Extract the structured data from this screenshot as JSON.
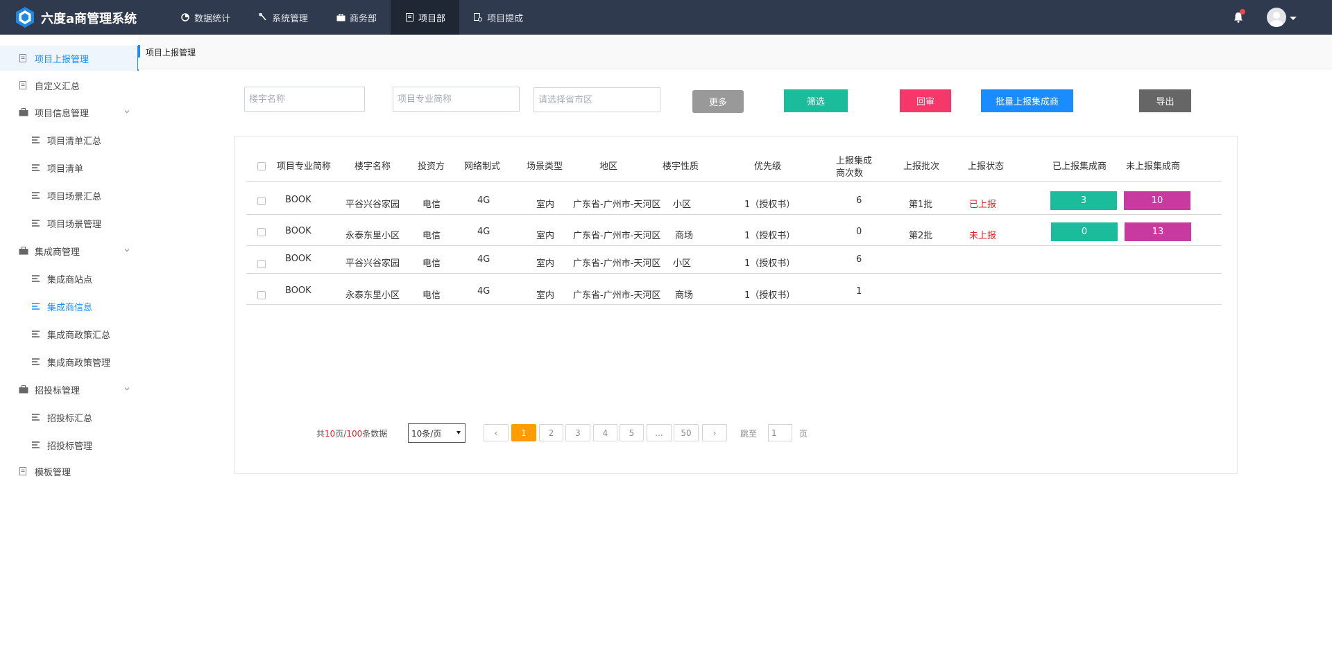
{
  "app": {
    "title": "六度a商管理系统",
    "nav": [
      {
        "label": "数据统计",
        "icon": "pie-chart-icon"
      },
      {
        "label": "系统管理",
        "icon": "wrench-icon"
      },
      {
        "label": "商务部",
        "icon": "briefcase-icon"
      },
      {
        "label": "项目部",
        "icon": "document-icon"
      },
      {
        "label": "项目提成",
        "icon": "commission-icon"
      }
    ],
    "active_nav": "项目部"
  },
  "sidebar": {
    "items": [
      {
        "label": "项目上报管理",
        "icon": "report-icon"
      },
      {
        "label": "自定义汇总",
        "icon": "report-icon"
      },
      {
        "label": "项目信息管理",
        "icon": "briefcase-icon"
      },
      {
        "label": "项目清单汇总",
        "icon": "list-icon"
      },
      {
        "label": "项目清单",
        "icon": "list-icon"
      },
      {
        "label": "项目场景汇总",
        "icon": "list-icon"
      },
      {
        "label": "项目场景管理",
        "icon": "list-icon"
      },
      {
        "label": "集成商管理",
        "icon": "briefcase-icon"
      },
      {
        "label": "集成商站点",
        "icon": "list-icon"
      },
      {
        "label": "集成商信息",
        "icon": "list-icon"
      },
      {
        "label": "集成商政策汇总",
        "icon": "list-icon"
      },
      {
        "label": "集成商政策管理",
        "icon": "list-icon"
      },
      {
        "label": "招投标管理",
        "icon": "briefcase-icon"
      },
      {
        "label": "招投标汇总",
        "icon": "list-icon"
      },
      {
        "label": "招投标管理",
        "icon": "list-icon"
      },
      {
        "label": "模板管理",
        "icon": "report-icon"
      }
    ]
  },
  "breadcrumb": "项目上报管理",
  "filters": {
    "building_placeholder": "楼宇名称",
    "project_abbr_placeholder": "项目专业简称",
    "region_placeholder": "请选择省市区",
    "more_label": "更多",
    "filter_label": "筛选",
    "review_label": "回审",
    "batch_report_label": "批量上报集成商",
    "export_label": "导出"
  },
  "colors": {
    "topbar": "#2f3a4e",
    "accent_blue": "#1a8cff",
    "teal": "#1abc9c",
    "magenta": "#c93aa1",
    "pink": "#f5386a",
    "gray_btn": "#999999",
    "dark_btn": "#666666",
    "orange": "#ff9c00",
    "status_red": "#e12424"
  },
  "table": {
    "headers": {
      "abbr": "项目专业简称",
      "building": "楼宇名称",
      "investor": "投资方",
      "network": "网络制式",
      "scene": "场景类型",
      "region": "地区",
      "nature": "楼宇性质",
      "priority": "优先级",
      "report_count_1": "上报集成",
      "report_count_2": "商次数",
      "batch": "上报批次",
      "status": "上报状态",
      "reported": "已上报集成商",
      "unreported": "未上报集成商"
    },
    "rows": [
      {
        "abbr": "BOOK",
        "building": "平谷兴谷家园",
        "investor": "电信",
        "network": "4G",
        "scene": "室内",
        "region": "广东省-广州市-天河区",
        "nature": "小区",
        "priority": "1（授权书）",
        "count": "6",
        "batch": "第1批",
        "status": "已上报",
        "reported": "3",
        "unreported": "10"
      },
      {
        "abbr": "BOOK",
        "building": "永泰东里小区",
        "investor": "电信",
        "network": "4G",
        "scene": "室内",
        "region": "广东省-广州市-天河区",
        "nature": "商场",
        "priority": "1（授权书）",
        "count": "0",
        "batch": "第2批",
        "status": "未上报",
        "reported": "0",
        "unreported": "13"
      },
      {
        "abbr": "BOOK",
        "building": "平谷兴谷家园",
        "investor": "电信",
        "network": "4G",
        "scene": "室内",
        "region": "广东省-广州市-天河区",
        "nature": "小区",
        "priority": "1（授权书）",
        "count": "6",
        "batch": "",
        "status": "",
        "reported": "",
        "unreported": ""
      },
      {
        "abbr": "BOOK",
        "building": "永泰东里小区",
        "investor": "电信",
        "network": "4G",
        "scene": "室内",
        "region": "广东省-广州市-天河区",
        "nature": "商场",
        "priority": "1（授权书）",
        "count": "1",
        "batch": "",
        "status": "",
        "reported": "",
        "unreported": ""
      }
    ]
  },
  "pagination": {
    "total_prefix": "共",
    "total_pages": "10",
    "total_mid": "页/",
    "total_records": "100",
    "total_suffix": "条数据",
    "page_size": "10条/页",
    "prev": "‹",
    "pages": [
      "1",
      "2",
      "3",
      "4",
      "5",
      "...",
      "50"
    ],
    "next": "›",
    "current": "1",
    "jump_label": "跳至",
    "jump_value": "1",
    "page_unit": "页"
  }
}
